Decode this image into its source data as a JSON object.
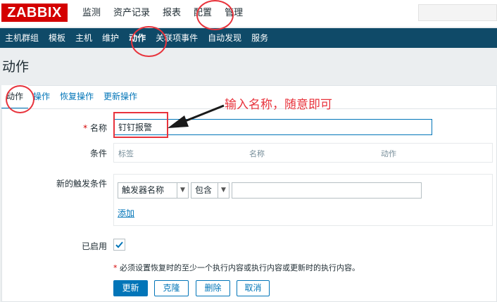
{
  "logo": "ZABBIX",
  "main_menu": [
    {
      "label": "监测",
      "name": "menu-monitoring"
    },
    {
      "label": "资产记录",
      "name": "menu-inventory"
    },
    {
      "label": "报表",
      "name": "menu-reports"
    },
    {
      "label": "配置",
      "name": "menu-configuration"
    },
    {
      "label": "管理",
      "name": "menu-administration"
    }
  ],
  "sub_menu": [
    {
      "label": "主机群组",
      "name": "submenu-host-groups"
    },
    {
      "label": "模板",
      "name": "submenu-templates"
    },
    {
      "label": "主机",
      "name": "submenu-hosts"
    },
    {
      "label": "维护",
      "name": "submenu-maintenance"
    },
    {
      "label": "动作",
      "name": "submenu-actions"
    },
    {
      "label": "关联项事件",
      "name": "submenu-event-correlation"
    },
    {
      "label": "自动发现",
      "name": "submenu-discovery"
    },
    {
      "label": "服务",
      "name": "submenu-services"
    }
  ],
  "page_title": "动作",
  "tabs": [
    {
      "label": "动作",
      "name": "tab-action"
    },
    {
      "label": "操作",
      "name": "tab-operations"
    },
    {
      "label": "恢复操作",
      "name": "tab-recovery-operations"
    },
    {
      "label": "更新操作",
      "name": "tab-update-operations"
    }
  ],
  "form": {
    "name_label": "名称",
    "name_value": "钉钉报警",
    "conditions_label": "条件",
    "conditions_headers": [
      "标签",
      "名称",
      "动作"
    ],
    "new_condition_label": "新的触发条件",
    "condition_type": "触发器名称",
    "condition_operator": "包含",
    "condition_value": "",
    "add_link": "添加",
    "enabled_label": "已启用",
    "enabled": true,
    "required_mark": "*",
    "note": "必须设置恢复时的至少一个执行内容或执行内容或更新时的执行内容。"
  },
  "buttons": {
    "update": "更新",
    "clone": "克隆",
    "delete": "删除",
    "cancel": "取消"
  },
  "annotation": {
    "text": "输入名称，随意即可",
    "color": "#e8333c"
  },
  "colors": {
    "brand_red": "#d40000",
    "submenu_bg": "#0f4a68",
    "link_blue": "#0275b8"
  }
}
